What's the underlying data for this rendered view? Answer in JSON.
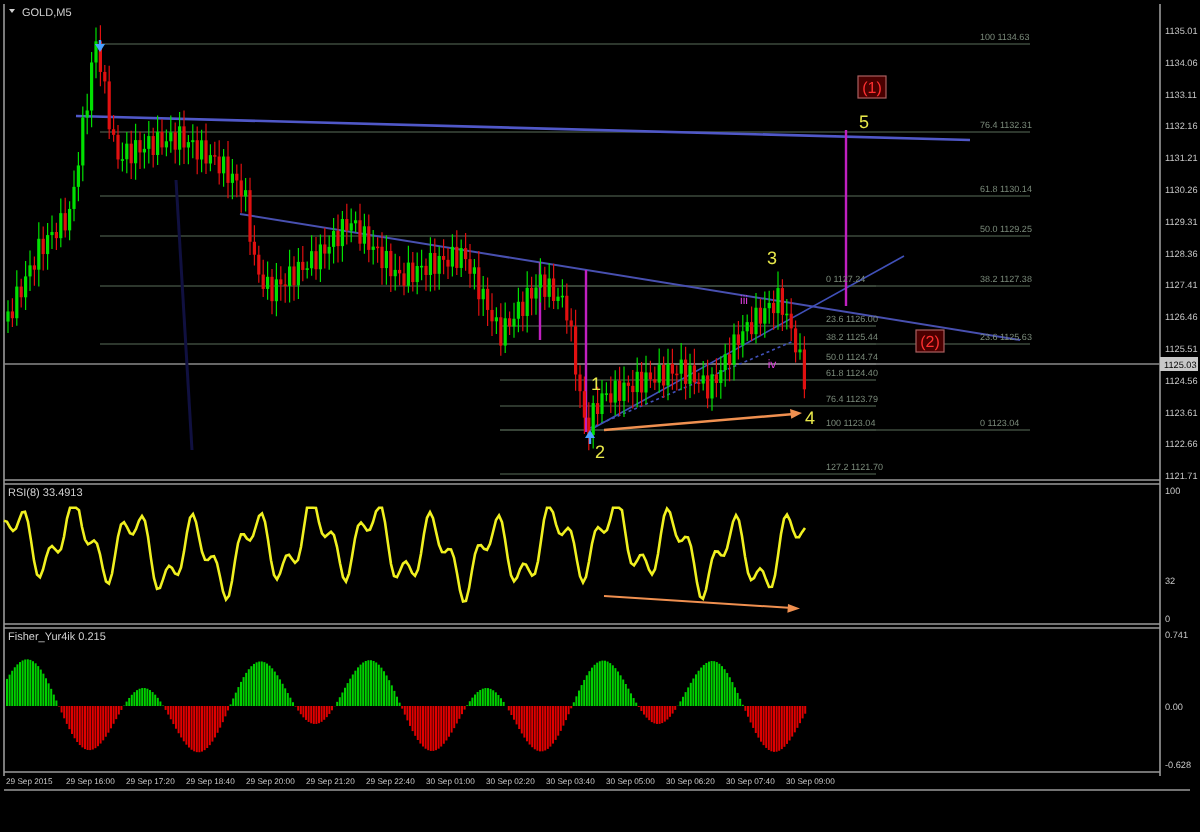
{
  "chart": {
    "title": "GOLD,M5",
    "price_axis": [
      "1135.01",
      "1134.06",
      "1133.11",
      "1132.16",
      "1131.21",
      "1130.26",
      "1129.31",
      "1128.36",
      "1127.41",
      "1126.46",
      "1125.51",
      "1124.56",
      "1123.61",
      "1122.66",
      "1121.71"
    ],
    "current_price": "1125.03",
    "fib_labels": [
      {
        "text": "100 1134.63"
      },
      {
        "text": "76.4 1132.31"
      },
      {
        "text": "61.8 1130.14"
      },
      {
        "text": "50.0 1129.25"
      },
      {
        "text": "0 1127.24"
      },
      {
        "text": "38.2 1127.38"
      },
      {
        "text": "23.6 1126.00"
      },
      {
        "text": "38.2 1125.44"
      },
      {
        "text": "23.6 1125.63"
      },
      {
        "text": "50.0 1124.74"
      },
      {
        "text": "61.8 1124.40"
      },
      {
        "text": "76.4 1123.79"
      },
      {
        "text": "100 1123.04"
      },
      {
        "text": "0 1123.04"
      },
      {
        "text": "127.2 1121.70"
      }
    ],
    "wave_labels": [
      {
        "text": "1",
        "kind": "wave"
      },
      {
        "text": "2",
        "kind": "wave"
      },
      {
        "text": "3",
        "kind": "wave"
      },
      {
        "text": "4",
        "kind": "wave"
      },
      {
        "text": "5",
        "kind": "wave"
      },
      {
        "text": "(1)",
        "kind": "boxed"
      },
      {
        "text": "(2)",
        "kind": "boxed"
      },
      {
        "text": "iii",
        "kind": "minor"
      },
      {
        "text": "iv",
        "kind": "minor"
      }
    ]
  },
  "rsi": {
    "label": "RSI(8) 33.4913",
    "axis": [
      "100",
      "32",
      "0"
    ]
  },
  "fisher": {
    "label": "Fisher_Yur4ik 0.215",
    "axis": [
      "0.741",
      "0.00",
      "-0.628"
    ]
  },
  "time_axis": [
    "29 Sep 2015",
    "29 Sep 16:00",
    "29 Sep 17:20",
    "29 Sep 18:40",
    "29 Sep 20:00",
    "29 Sep 21:20",
    "29 Sep 22:40",
    "30 Sep 01:00",
    "30 Sep 02:20",
    "30 Sep 03:40",
    "30 Sep 05:00",
    "30 Sep 06:20",
    "30 Sep 07:40",
    "30 Sep 09:00"
  ]
}
